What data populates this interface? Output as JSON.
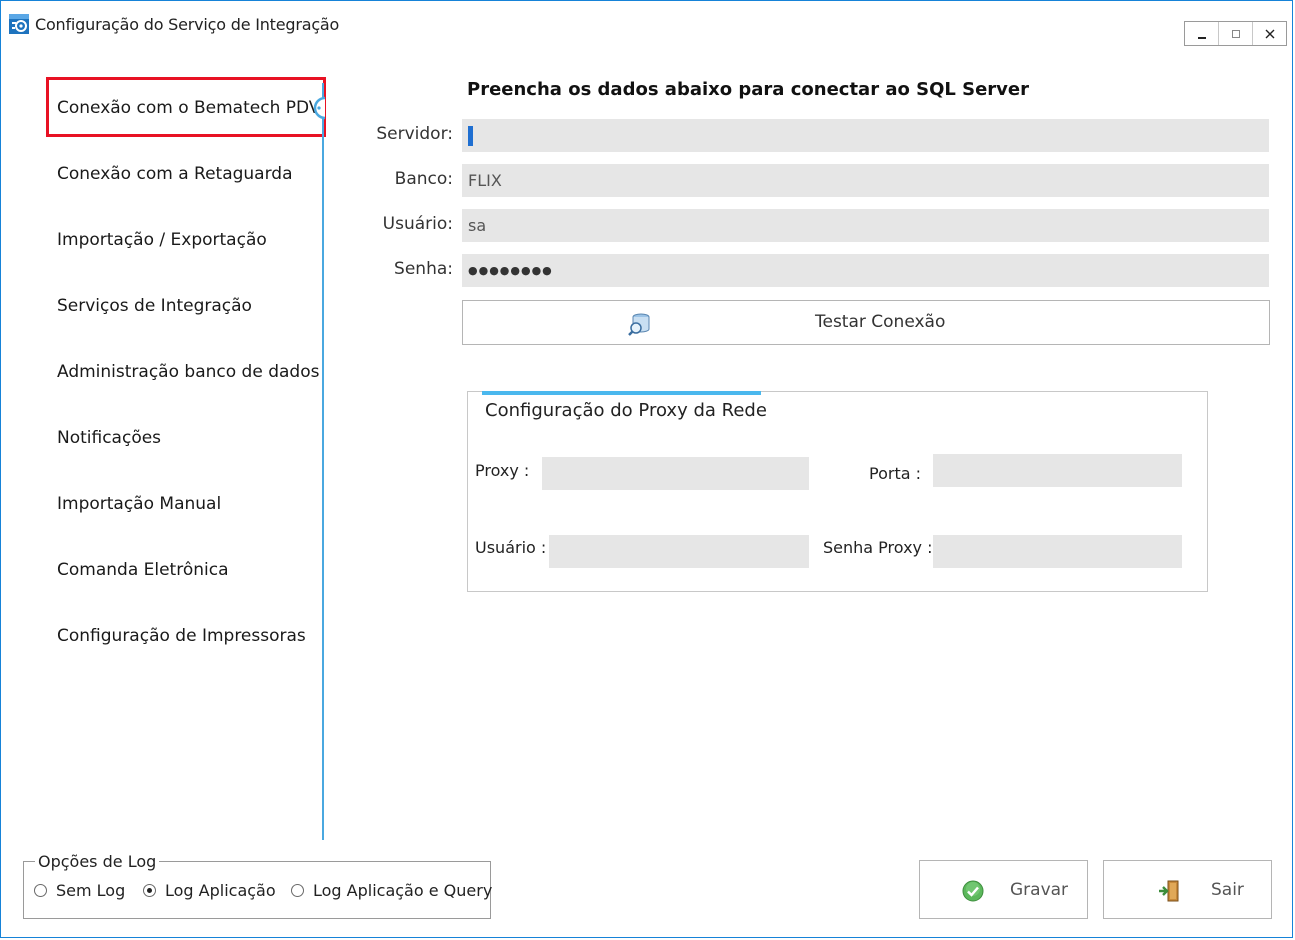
{
  "window": {
    "title": "Configuração do Serviço de Integração",
    "controls": {
      "minimize": "_",
      "maximize": "□",
      "close": "✕"
    }
  },
  "sidebar": {
    "items": [
      {
        "label": "Conexão com o Bematech PDV",
        "selected": true
      },
      {
        "label": "Conexão com a Retaguarda"
      },
      {
        "label": "Importação / Exportação"
      },
      {
        "label": "Serviços de Integração"
      },
      {
        "label": "Administração banco de dados"
      },
      {
        "label": "Notificações"
      },
      {
        "label": "Importação Manual"
      },
      {
        "label": "Comanda Eletrônica"
      },
      {
        "label": "Configuração de Impressoras"
      }
    ],
    "accent_color": "#4aa8e0",
    "highlight_color": "#e81123"
  },
  "form": {
    "heading": "Preencha os dados abaixo para conectar ao SQL Server",
    "servidor": {
      "label": "Servidor:",
      "value": ""
    },
    "banco": {
      "label": "Banco:",
      "value": "FLIX"
    },
    "usuario": {
      "label": "Usuário:",
      "value": "sa"
    },
    "senha": {
      "label": "Senha:",
      "value": "●●●●●●●●"
    },
    "test_button": {
      "label": "Testar Conexão",
      "icon": "database-search-icon"
    }
  },
  "proxy": {
    "title": "Configuração do Proxy da Rede",
    "proxy_label": "Proxy :",
    "porta_label": "Porta :",
    "usuario_label": "Usuário :",
    "senha_label": "Senha Proxy :",
    "proxy_value": "",
    "porta_value": "",
    "usuario_value": "",
    "senha_value": ""
  },
  "log_options": {
    "legend": "Opções de Log",
    "options": [
      {
        "label": "Sem Log",
        "checked": false
      },
      {
        "label": "Log Aplicação",
        "checked": true
      },
      {
        "label": "Log Aplicação e Query",
        "checked": false
      }
    ]
  },
  "actions": {
    "gravar": {
      "label": "Gravar",
      "icon": "check-circle-icon",
      "color": "#4caf50"
    },
    "sair": {
      "label": "Sair",
      "icon": "exit-door-icon"
    }
  }
}
